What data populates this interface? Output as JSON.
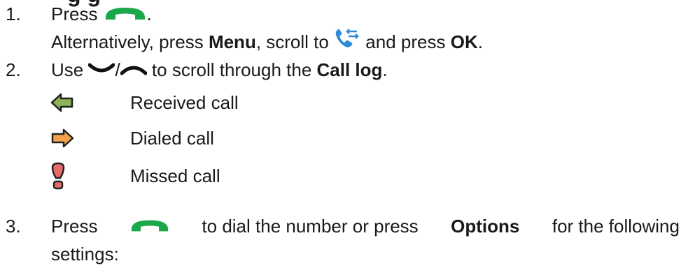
{
  "heading": {
    "partial_text": "g      g"
  },
  "steps": [
    {
      "number": "1.",
      "line1": {
        "before": "Press",
        "after": "."
      },
      "line2": {
        "part1": "Alternatively, press ",
        "bold1": "Menu",
        "part2": ", scroll to ",
        "part3": " and press ",
        "bold2": "OK",
        "part4": "."
      }
    },
    {
      "number": "2.",
      "line1": {
        "part1": "Use ",
        "sep": "/",
        "part2": " to scroll through the ",
        "bold": "Call log",
        "part3": "."
      }
    },
    {
      "number": "3.",
      "line1": {
        "part1": "Press ",
        "part2": " to dial the number or press ",
        "bold": "Options",
        "part3": " for the following"
      },
      "line2": "settings:"
    }
  ],
  "legend": [
    {
      "icon": "received-call-arrow-icon",
      "label": "Received call",
      "color": "#8db35a"
    },
    {
      "icon": "dialed-call-arrow-icon",
      "label": "Dialed call",
      "color": "#f5a04a"
    },
    {
      "icon": "missed-call-exclamation-icon",
      "label": "Missed call",
      "color": "#e86a6a"
    }
  ],
  "colors": {
    "call_key_green": "#1aa84a",
    "phone_icon_blue": "#2e8ad8"
  }
}
